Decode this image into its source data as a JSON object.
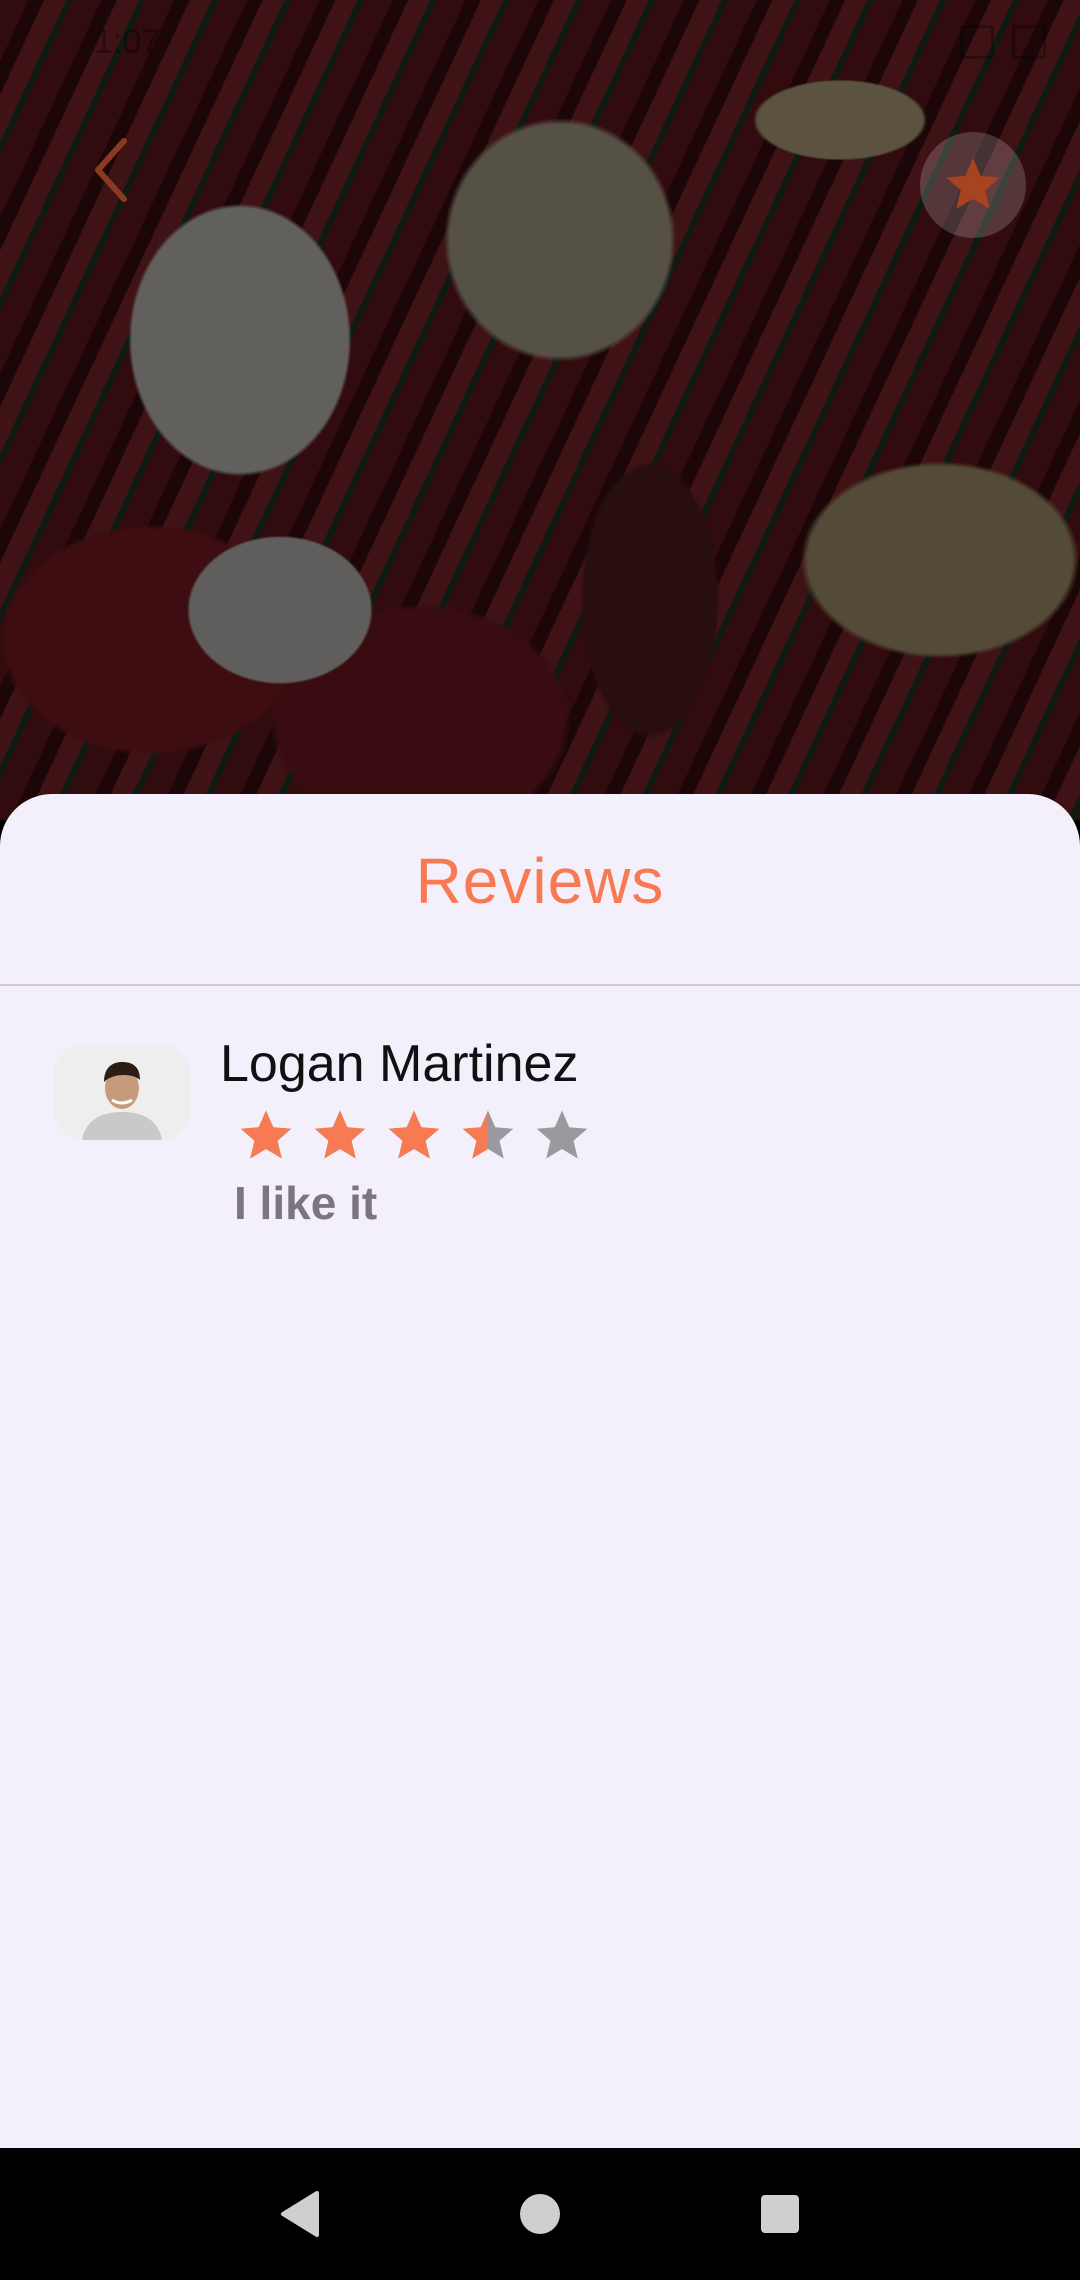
{
  "status_bar": {
    "time": "1:07"
  },
  "sheet": {
    "title": "Reviews"
  },
  "reviews": [
    {
      "name": "Logan Martinez",
      "rating": 3.5,
      "max_rating": 5,
      "text": "I like it"
    }
  ],
  "colors": {
    "accent": "#f77a52",
    "star_empty": "#9a9a9e",
    "sheet_bg": "#f4f0fb"
  },
  "icons": {
    "back": "chevron-left-icon",
    "favorite": "star-icon",
    "nav_back": "triangle-back-icon",
    "nav_home": "circle-home-icon",
    "nav_recents": "square-recents-icon"
  }
}
